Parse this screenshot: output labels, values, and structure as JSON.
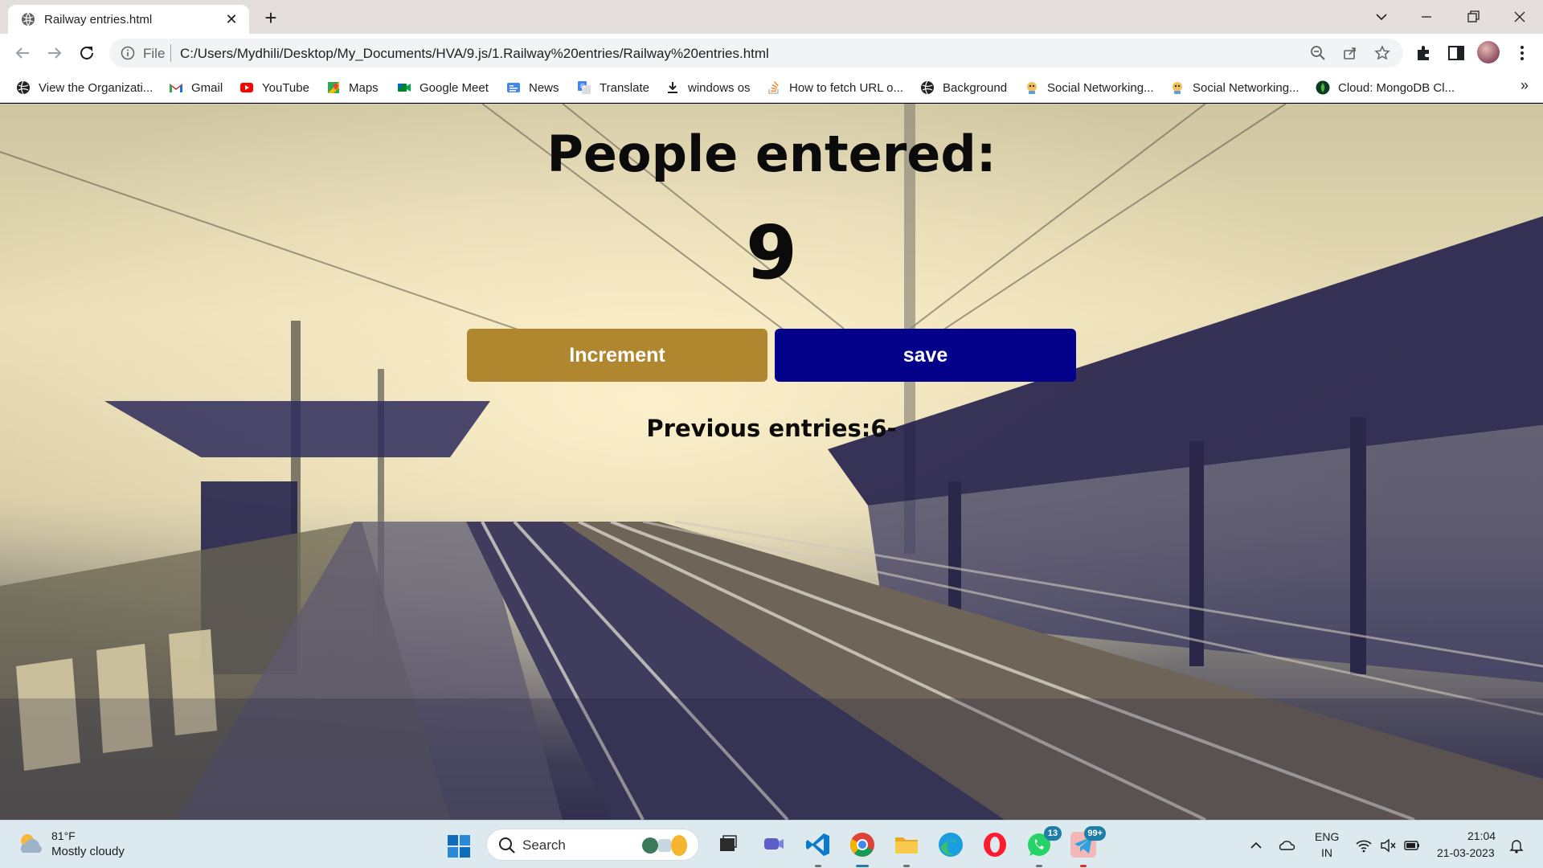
{
  "browser": {
    "tab_title": "Railway entries.html",
    "address_scheme_label": "File",
    "address_url": "C:/Users/Mydhili/Desktop/My_Documents/HVA/9.js/1.Railway%20entries/Railway%20entries.html"
  },
  "bookmarks": [
    {
      "label": "View the Organizati...",
      "icon": "globe-icon"
    },
    {
      "label": "Gmail",
      "icon": "gmail-icon"
    },
    {
      "label": "YouTube",
      "icon": "youtube-icon"
    },
    {
      "label": "Maps",
      "icon": "maps-icon"
    },
    {
      "label": "Google Meet",
      "icon": "meet-icon"
    },
    {
      "label": "News",
      "icon": "news-icon"
    },
    {
      "label": "Translate",
      "icon": "translate-icon"
    },
    {
      "label": "windows os",
      "icon": "download-icon"
    },
    {
      "label": "How to fetch URL o...",
      "icon": "stackoverflow-icon"
    },
    {
      "label": "Background",
      "icon": "globe-icon"
    },
    {
      "label": "Social Networking...",
      "icon": "social-icon"
    },
    {
      "label": "Social Networking...",
      "icon": "social-icon"
    },
    {
      "label": "Cloud: MongoDB Cl...",
      "icon": "mongodb-icon"
    }
  ],
  "page": {
    "heading": "People entered:",
    "count": "9",
    "increment_label": "Increment",
    "save_label": "save",
    "previous_entries": "Previous entries:6-"
  },
  "colors": {
    "increment_button": "#b0862f",
    "save_button": "#04028a"
  },
  "taskbar": {
    "weather_temp": "81°F",
    "weather_desc": "Mostly cloudy",
    "search_label": "Search",
    "whatsapp_badge": "13",
    "telegram_badge": "99+",
    "lang_line1": "ENG",
    "lang_line2": "IN",
    "time": "21:04",
    "date": "21-03-2023"
  }
}
